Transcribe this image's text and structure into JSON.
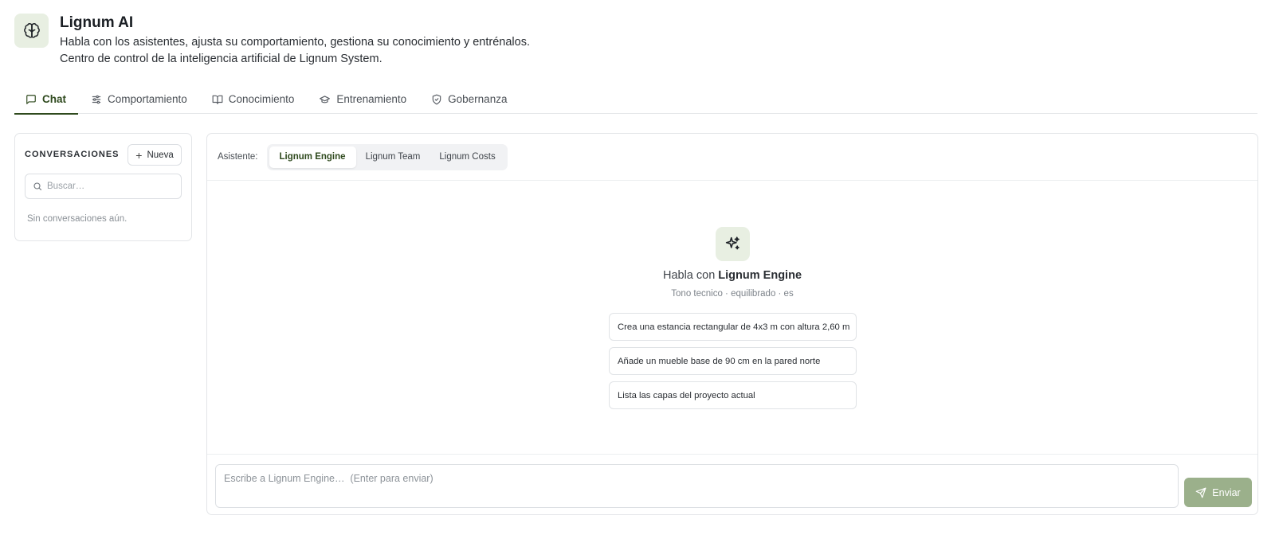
{
  "header": {
    "title": "Lignum AI",
    "description": "Habla con los asistentes, ajusta su comportamiento, gestiona su conocimiento y entrénalos.",
    "subtitle": "Centro de control de la inteligencia artificial de Lignum System.",
    "icon": "brain-icon"
  },
  "tabs": [
    {
      "label": "Chat",
      "icon": "message-square-icon",
      "active": true
    },
    {
      "label": "Comportamiento",
      "icon": "sliders-icon",
      "active": false
    },
    {
      "label": "Conocimiento",
      "icon": "book-open-icon",
      "active": false
    },
    {
      "label": "Entrenamiento",
      "icon": "graduation-cap-icon",
      "active": false
    },
    {
      "label": "Gobernanza",
      "icon": "shield-check-icon",
      "active": false
    }
  ],
  "sidebar": {
    "title": "CONVERSACIONES",
    "new_label": "Nueva",
    "search_placeholder": "Buscar…",
    "empty_text": "Sin conversaciones aún."
  },
  "assistant": {
    "label": "Asistente:",
    "options": [
      "Lignum Engine",
      "Lignum Team",
      "Lignum Costs"
    ],
    "selected": "Lignum Engine"
  },
  "intro": {
    "prefix": "Habla con",
    "name": "Lignum Engine",
    "tone": "Tono tecnico · equilibrado · es"
  },
  "suggestions": [
    "Crea una estancia rectangular de 4x3 m con altura 2,60 m",
    "Añade un mueble base de 90 cm en la pared norte",
    "Lista las capas del proyecto actual"
  ],
  "composer": {
    "placeholder": "Escribe a Lignum Engine…  (Enter para enviar)",
    "send_label": "Enviar"
  },
  "colors": {
    "accent": "#2f4a1e",
    "accent_soft": "#e8efe2",
    "send_button": "#9bb08b"
  }
}
